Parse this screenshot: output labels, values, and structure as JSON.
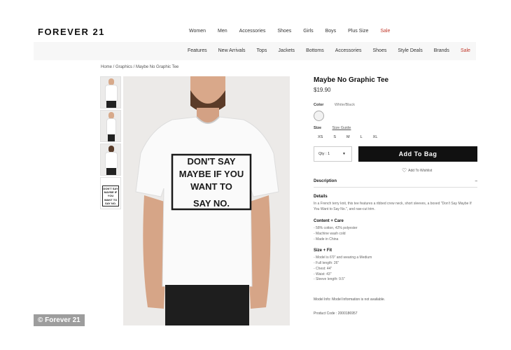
{
  "brand": {
    "logo": "FOREVER 21"
  },
  "nav_top": [
    "Women",
    "Men",
    "Accessories",
    "Shoes",
    "Girls",
    "Boys",
    "Plus Size",
    "Sale"
  ],
  "nav_sub": [
    "Features",
    "New Arrivals",
    "Tops",
    "Jackets",
    "Bottoms",
    "Accessories",
    "Shoes",
    "Style Deals",
    "Brands",
    "Sale"
  ],
  "breadcrumb": "Home / Graphics / Maybe No Graphic Tee",
  "product": {
    "title": "Maybe No Graphic Tee",
    "price": "$19.90",
    "color_label": "Color",
    "color_value": "White/Black",
    "size_label": "Size",
    "size_guide": "Size Guide",
    "sizes": [
      "XS",
      "S",
      "M",
      "L",
      "XL"
    ],
    "qty_label": "Qty : 1",
    "add_to_bag": "Add To Bag",
    "wishlist": "Add To Wishlist",
    "description_label": "Description",
    "description_toggle": "–",
    "tee_graphic": [
      "DON'T SAY",
      "MAYBE IF YOU",
      "WANT TO",
      "SAY NO."
    ],
    "details": {
      "heading": "Details",
      "text": "In a French terry knit, this tee features a ribbed crew neck, short sleeves, a boxed \"Don't Say Maybe If You Want to Say No.\", and raw-cut trim."
    },
    "content_care": {
      "heading": "Content + Care",
      "lines": [
        "- 58% cotton, 42% polyester",
        "- Machine wash cold",
        "- Made in China"
      ]
    },
    "size_fit": {
      "heading": "Size + Fit",
      "lines": [
        "- Model is 6'0\" and wearing a Medium",
        "- Full length: 26\"",
        "- Chest: 44\"",
        "- Waist: 43\"",
        "- Sleeve length: 9.5\""
      ]
    },
    "model_info": "Model Info: Model Information is not available.",
    "product_code": "Product Code : 2000186957"
  },
  "watermark": "© Forever 21"
}
